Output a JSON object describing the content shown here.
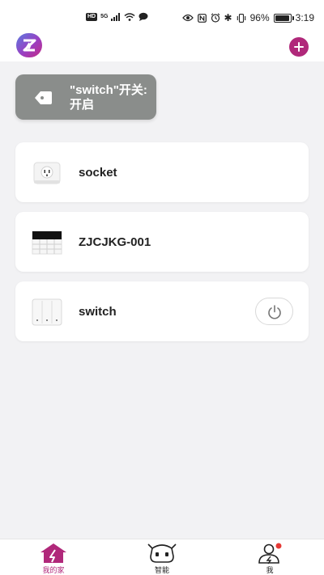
{
  "status_bar": {
    "network_badge": "HD",
    "network_type": "5G",
    "battery_percent": "96%",
    "battery_level": 0.96,
    "time": "3:19"
  },
  "header": {
    "logo_icon": "app-logo-icon",
    "add_icon": "plus-circle-icon",
    "accent_color": "#b0287a"
  },
  "scene": {
    "label": "\"switch\"开关:开启",
    "icon": "tag-icon",
    "tile_color": "#8a8d8b"
  },
  "devices": [
    {
      "name": "socket",
      "icon": "socket-icon",
      "has_power_toggle": false
    },
    {
      "name": "ZJCJKG-001",
      "icon": "control-panel-icon",
      "has_power_toggle": false
    },
    {
      "name": "switch",
      "icon": "wall-switch-icon",
      "has_power_toggle": true
    }
  ],
  "bottom_nav": {
    "items": [
      {
        "label": "我的家",
        "icon": "home-icon",
        "active": true
      },
      {
        "label": "智能",
        "icon": "robot-icon",
        "active": false
      },
      {
        "label": "我",
        "icon": "profile-icon",
        "active": false,
        "has_notification_dot": true
      }
    ]
  }
}
